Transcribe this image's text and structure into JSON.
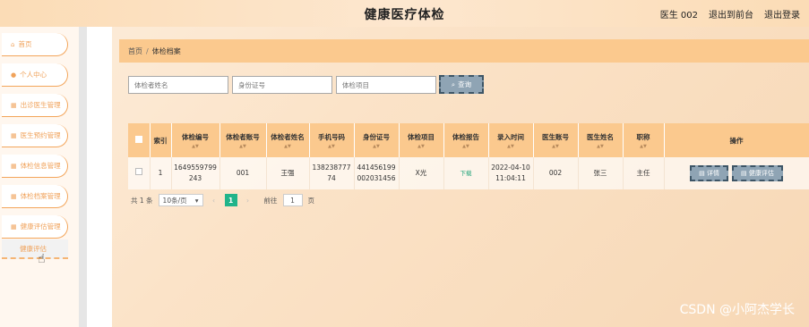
{
  "header": {
    "title": "健康医疗体检",
    "user": "医生 002",
    "back_front": "退出到前台",
    "logout": "退出登录"
  },
  "sidebar": {
    "items": [
      {
        "label": "首页",
        "icon": "home-icon"
      },
      {
        "label": "个人中心",
        "icon": "user-icon"
      },
      {
        "label": "出诊医生管理",
        "icon": "grid-icon"
      },
      {
        "label": "医生预约管理",
        "icon": "grid-icon"
      },
      {
        "label": "体检信息管理",
        "icon": "grid-icon"
      },
      {
        "label": "体检档案管理",
        "icon": "grid-icon"
      },
      {
        "label": "健康评估管理",
        "icon": "grid-icon"
      }
    ],
    "active_sub": "健康评估"
  },
  "breadcrumb": {
    "home": "首页",
    "sep": "/",
    "current": "体检档案"
  },
  "search": {
    "name_placeholder": "体检者姓名",
    "id_placeholder": "身份证号",
    "item_placeholder": "体检项目",
    "button": "查询"
  },
  "table": {
    "headers": [
      "索引",
      "体检编号",
      "体检者账号",
      "体检者姓名",
      "手机号码",
      "身份证号",
      "体检项目",
      "体检报告",
      "录入时间",
      "医生账号",
      "医生姓名",
      "职称",
      "操作"
    ],
    "row": {
      "index": "1",
      "exam_no": "1649559799243",
      "account": "001",
      "name": "王强",
      "phone": "13823877774",
      "id_no": "441456199002031456",
      "item": "X光",
      "report": "下载",
      "time": "2022-04-10 11:04:11",
      "doctor_account": "002",
      "doctor_name": "张三",
      "title": "主任",
      "detail_btn": "详情",
      "assess_btn": "健康评估"
    }
  },
  "pagination": {
    "total": "共 1 条",
    "page_size": "10条/页",
    "current_page": "1",
    "goto_label": "前往",
    "goto_value": "1",
    "page_unit": "页"
  },
  "watermark": "CSDN @小阿杰学长"
}
